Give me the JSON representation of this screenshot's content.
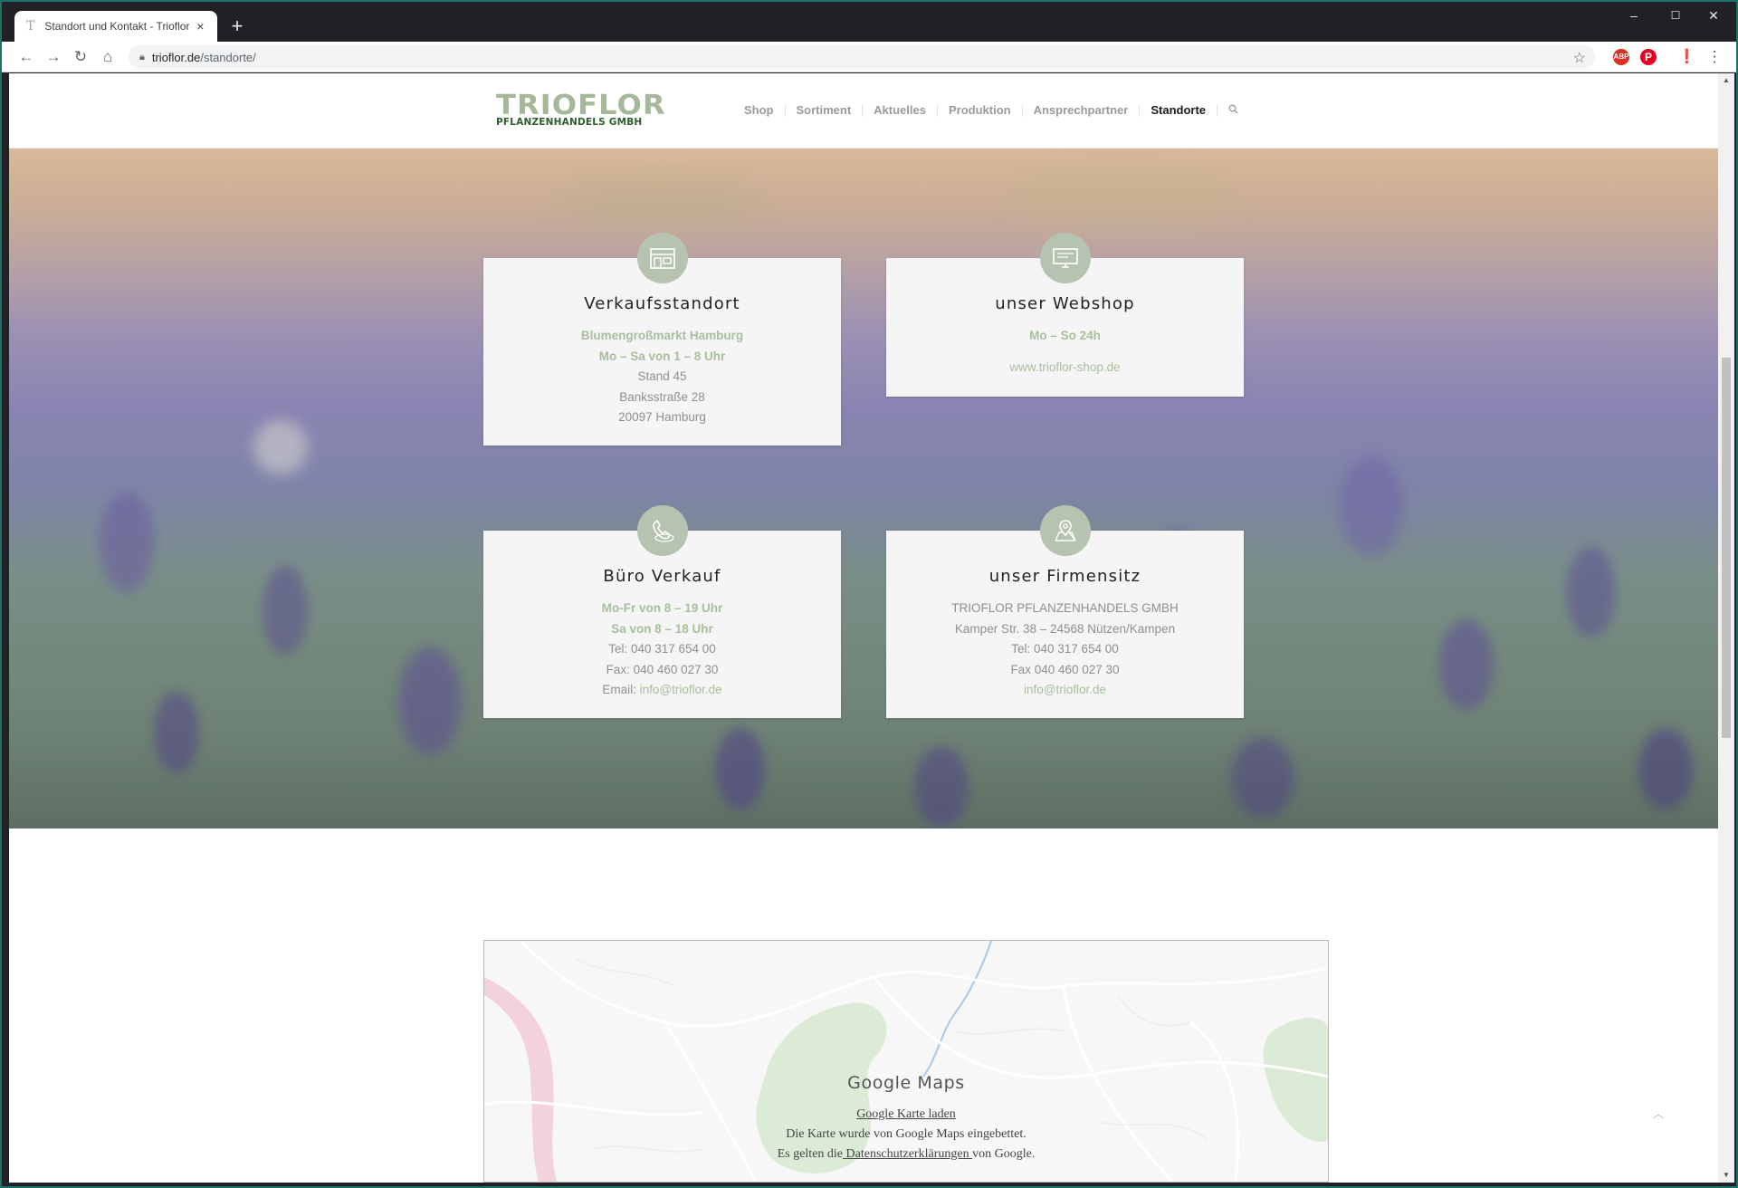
{
  "browser": {
    "tab_title": "Standort und Kontakt - Trioflor P",
    "tab_close": "×",
    "new_tab": "+",
    "url_host": "trioflor.de",
    "url_path": "/standorte/",
    "window_controls": {
      "minimize": "–",
      "maximize": "☐",
      "close": "✕"
    },
    "extensions": {
      "abp": "ABP"
    }
  },
  "site": {
    "logo_top": "TRIOFLOR",
    "logo_bottom": "PFLANZENHANDELS GMBH",
    "nav": [
      "Shop",
      "Sortiment",
      "Aktuelles",
      "Produktion",
      "Ansprechpartner",
      "Standorte"
    ],
    "active_nav": "Standorte"
  },
  "cards": {
    "verkauf": {
      "title": "Verkaufsstandort",
      "hl1": "Blumengroßmarkt Hamburg",
      "hl2": "Mo – Sa von 1 – 8 Uhr",
      "line1": "Stand 45",
      "line2": "Banksstraße 28",
      "line3": "20097 Hamburg"
    },
    "webshop": {
      "title": "unser Webshop",
      "hl1": "Mo – So 24h",
      "link": "www.trioflor-shop.de"
    },
    "buero": {
      "title": "Büro Verkauf",
      "hl1": "Mo-Fr von 8 – 19 Uhr",
      "hl2": "Sa von 8 – 18 Uhr",
      "tel": "Tel: 040 317 654 00",
      "fax": "Fax: 040 460 027 30",
      "email_label": "Email:",
      "email": "info@trioflor.de"
    },
    "firmensitz": {
      "title": "unser Firmensitz",
      "line1": "TRIOFLOR PFLANZENHANDELS GMBH",
      "line2": "Kamper Str. 38 – 24568 Nützen/Kampen",
      "tel": "Tel: 040 317 654 00",
      "fax": "Fax 040 460 027 30",
      "email": "info@trioflor.de"
    }
  },
  "map": {
    "title": "Google Maps",
    "load_link": "Google Karte laden",
    "note": "Die Karte wurde von Google Maps eingebettet.",
    "privacy_prefix": "Es gelten die",
    "privacy_link": " Datenschutzerklärungen ",
    "privacy_suffix": "von Google."
  },
  "icons": {
    "card_icons": [
      "store-icon",
      "monitor-icon",
      "phone-icon",
      "map-pin-icon"
    ]
  },
  "colors": {
    "accent_green": "#a7bf9d",
    "badge_green": "#b5c3b0",
    "logo_green_light": "#a6b89a",
    "logo_green_dark": "#2f5d2d"
  }
}
